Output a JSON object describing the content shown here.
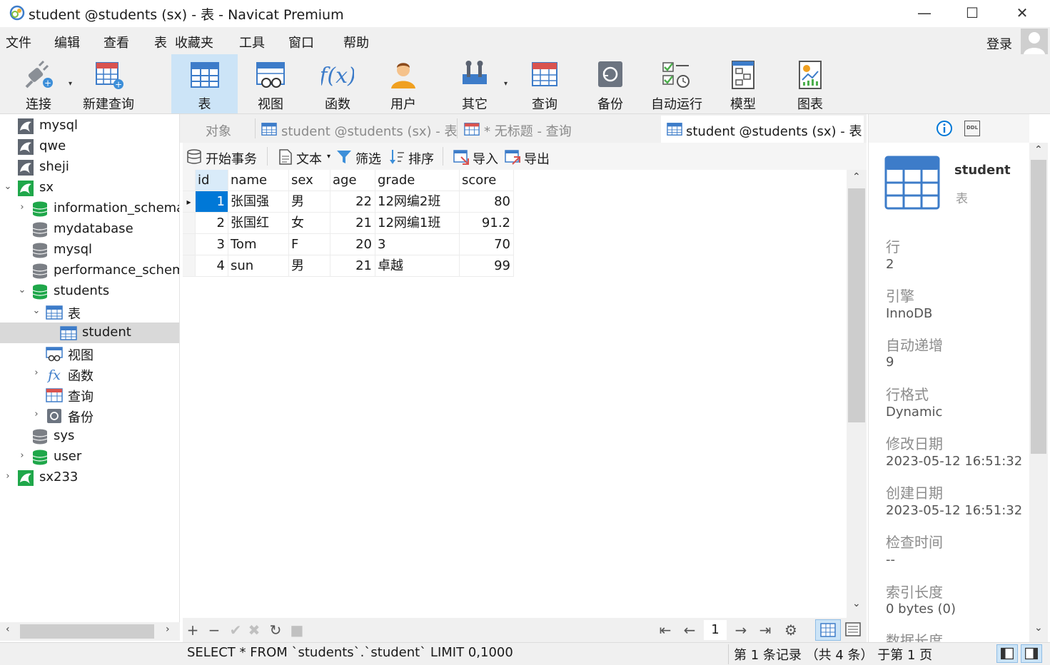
{
  "window": {
    "title": "student @students (sx) - 表 - Navicat Premium",
    "min_symbol": "—",
    "max_symbol": "☐",
    "close_symbol": "✕"
  },
  "menu": {
    "items": [
      "文件",
      "编辑",
      "查看",
      "表",
      "收藏夹",
      "工具",
      "窗口",
      "帮助"
    ],
    "login": "登录"
  },
  "toolbar": {
    "buttons": [
      {
        "label": "连接",
        "icon": "plug-icon"
      },
      {
        "label": "新建查询",
        "icon": "new-query-icon"
      },
      {
        "label": "表",
        "icon": "table-icon",
        "active": true
      },
      {
        "label": "视图",
        "icon": "view-icon"
      },
      {
        "label": "函数",
        "icon": "function-icon"
      },
      {
        "label": "用户",
        "icon": "user-icon"
      },
      {
        "label": "其它",
        "icon": "tools-icon"
      },
      {
        "label": "查询",
        "icon": "query-icon"
      },
      {
        "label": "备份",
        "icon": "backup-icon"
      },
      {
        "label": "自动运行",
        "icon": "schedule-icon"
      },
      {
        "label": "模型",
        "icon": "model-icon"
      },
      {
        "label": "图表",
        "icon": "chart-icon"
      }
    ],
    "dropdown_symbol": "▾"
  },
  "nav": {
    "tree": [
      {
        "label": "mysql",
        "type": "connection"
      },
      {
        "label": "qwe",
        "type": "connection"
      },
      {
        "label": "sheji",
        "type": "connection"
      },
      {
        "label": "sx",
        "type": "connection-open"
      },
      {
        "label": "information_schema",
        "type": "db-green"
      },
      {
        "label": "mydatabase",
        "type": "db-gray"
      },
      {
        "label": "mysql",
        "type": "db-gray"
      },
      {
        "label": "performance_schema",
        "type": "db-gray"
      },
      {
        "label": "students",
        "type": "db-green"
      },
      {
        "label": "表",
        "type": "table-folder"
      },
      {
        "label": "student",
        "type": "table",
        "selected": true
      },
      {
        "label": "视图",
        "type": "view-folder"
      },
      {
        "label": "函数",
        "type": "function-folder"
      },
      {
        "label": "查询",
        "type": "query-folder"
      },
      {
        "label": "备份",
        "type": "backup-folder"
      },
      {
        "label": "sys",
        "type": "db-gray"
      },
      {
        "label": "user",
        "type": "db-green"
      },
      {
        "label": "sx233",
        "type": "connection"
      }
    ],
    "expand": "›",
    "collapse": "⌄",
    "scroll_left": "‹",
    "scroll_right": "›"
  },
  "tabs": [
    {
      "label": "对象"
    },
    {
      "label": "student @students (sx) - 表"
    },
    {
      "label": "* 无标题 - 查询"
    },
    {
      "label": "student @students (sx) - 表"
    }
  ],
  "editor_tools": {
    "begin_tx": "开始事务",
    "text": "文本",
    "filter": "筛选",
    "sort": "排序",
    "import": "导入",
    "export": "导出"
  },
  "grid": {
    "columns": [
      "id",
      "name",
      "sex",
      "age",
      "grade",
      "score"
    ],
    "rows": [
      [
        "1",
        "张国强",
        "男",
        "22",
        "12网编2班",
        "80"
      ],
      [
        "2",
        "张国红",
        "女",
        "21",
        "12网编1班",
        "91.2"
      ],
      [
        "3",
        "Tom",
        "F",
        "20",
        "3",
        "70"
      ],
      [
        "4",
        "sun",
        "男",
        "21",
        "卓越",
        "99"
      ]
    ],
    "row_marker": "▸",
    "scroll_up": "⌃",
    "scroll_down": "⌄"
  },
  "gridbar": {
    "add": "+",
    "remove": "−",
    "apply": "✔",
    "discard": "✖",
    "refresh": "↻",
    "stop": "■",
    "first": "⇤",
    "prev": "←",
    "page": "1",
    "next": "→",
    "last": "⇥",
    "settings": "⚙"
  },
  "info": {
    "name": "student",
    "type": "表",
    "props": [
      {
        "label": "行",
        "value": "2"
      },
      {
        "label": "引擎",
        "value": "InnoDB"
      },
      {
        "label": "自动递增",
        "value": "9"
      },
      {
        "label": "行格式",
        "value": "Dynamic"
      },
      {
        "label": "修改日期",
        "value": "2023-05-12 16:51:32"
      },
      {
        "label": "创建日期",
        "value": "2023-05-12 16:51:32"
      },
      {
        "label": "检查时间",
        "value": "--"
      },
      {
        "label": "索引长度",
        "value": "0 bytes (0)"
      },
      {
        "label": "数据长度",
        "value": ""
      }
    ],
    "ddl_label": "DDL"
  },
  "status": {
    "sql": "SELECT * FROM `students`.`student` LIMIT 0,1000",
    "records": "第 1 条记录 （共 4 条） 于第 1 页"
  },
  "colors": {
    "accent": "#0078d7",
    "selection": "#cce4f7",
    "db_green": "#1fa74a",
    "table_blue": "#3d7cc9"
  }
}
